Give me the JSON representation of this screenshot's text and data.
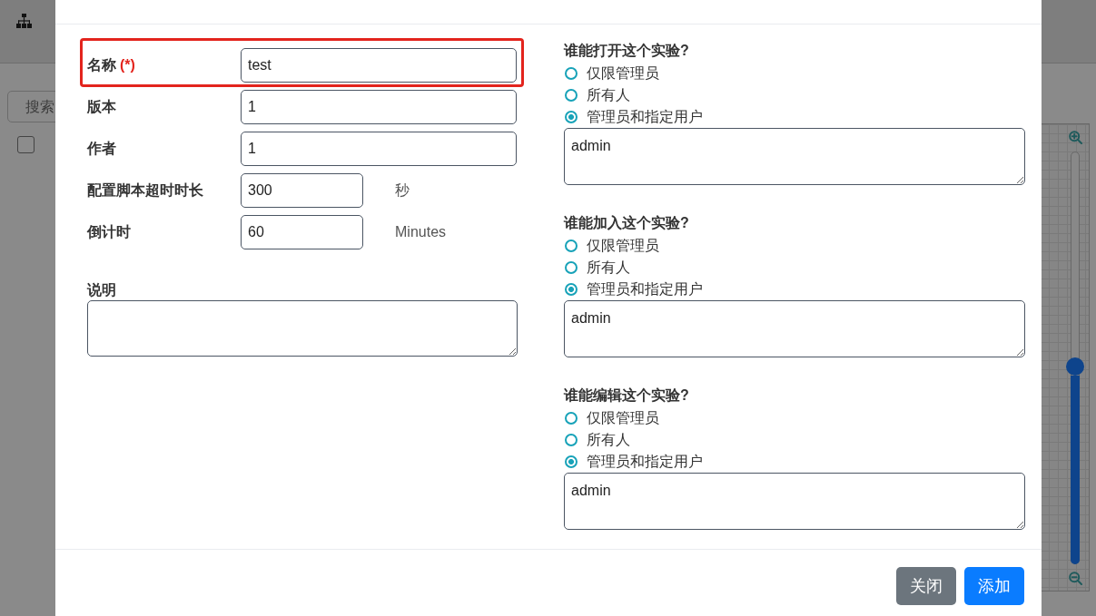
{
  "page": {
    "search": {
      "placeholder": "搜索"
    },
    "row_checkbox": {
      "checked": false
    },
    "zoom_slider": {
      "level": 0.48
    }
  },
  "dialog": {
    "fields": [
      {
        "kind": "text",
        "label": "名称",
        "required_mark": "(*)",
        "value": "test",
        "highlighted": true
      },
      {
        "kind": "text",
        "label": "版本",
        "value": "1",
        "highlighted": false
      },
      {
        "kind": "text",
        "label": "作者",
        "value": "1",
        "highlighted": false
      },
      {
        "kind": "number",
        "label": "配置脚本超时时长",
        "value": "300",
        "unit": "秒",
        "highlighted": false
      },
      {
        "kind": "number",
        "label": "倒计时",
        "value": "60",
        "unit": "Minutes",
        "highlighted": false
      }
    ],
    "description": {
      "label": "说明"
    },
    "permissions": [
      {
        "title": "谁能打开这个实验?",
        "options": [
          {
            "label": "仅限管理员",
            "selected": false
          },
          {
            "label": "所有人",
            "selected": false
          },
          {
            "label": "管理员和指定用户",
            "selected": true
          }
        ],
        "users": "admin"
      },
      {
        "title": "谁能加入这个实验?",
        "options": [
          {
            "label": "仅限管理员",
            "selected": false
          },
          {
            "label": "所有人",
            "selected": false
          },
          {
            "label": "管理员和指定用户",
            "selected": true
          }
        ],
        "users": "admin"
      },
      {
        "title": "谁能编辑这个实验?",
        "options": [
          {
            "label": "仅限管理员",
            "selected": false
          },
          {
            "label": "所有人",
            "selected": false
          },
          {
            "label": "管理员和指定用户",
            "selected": true
          }
        ],
        "users": "admin"
      }
    ],
    "buttons": [
      {
        "kind": "secondary",
        "label": "关闭"
      },
      {
        "kind": "primary",
        "label": "添加"
      }
    ]
  }
}
